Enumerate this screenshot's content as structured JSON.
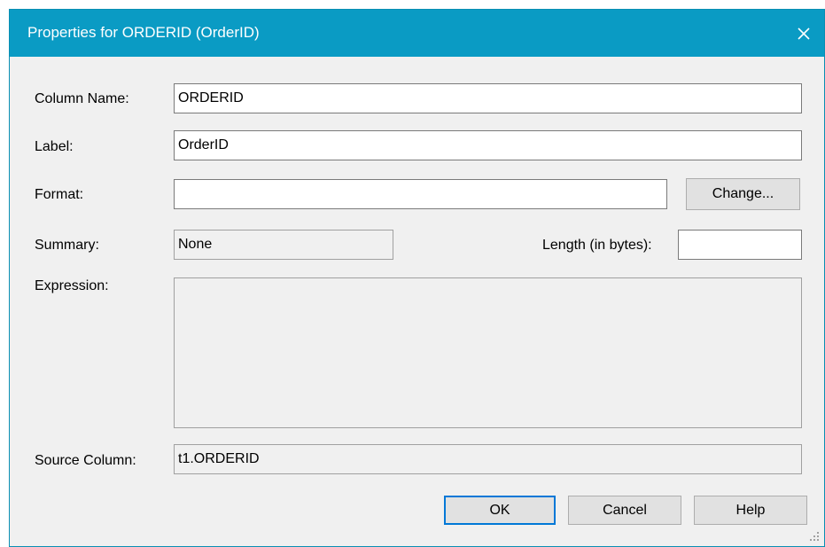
{
  "window": {
    "title": "Properties for ORDERID (OrderID)",
    "close_glyph": "✕",
    "titlebar_color": "#0a9bc4"
  },
  "form": {
    "column_name": {
      "label": "Column Name:",
      "value": "ORDERID"
    },
    "label": {
      "label": "Label:",
      "value": "OrderID"
    },
    "format": {
      "label": "Format:",
      "value": "",
      "change_button": "Change..."
    },
    "summary": {
      "label": "Summary:",
      "value": "None"
    },
    "length": {
      "label": "Length (in bytes):",
      "value": ""
    },
    "expression": {
      "label": "Expression:",
      "value": ""
    },
    "source_column": {
      "label": "Source Column:",
      "value": "t1.ORDERID"
    }
  },
  "buttons": {
    "ok": "OK",
    "cancel": "Cancel",
    "help": "Help"
  },
  "icons": {
    "close": "close-icon",
    "resize_grip": "resize-grip-icon"
  }
}
